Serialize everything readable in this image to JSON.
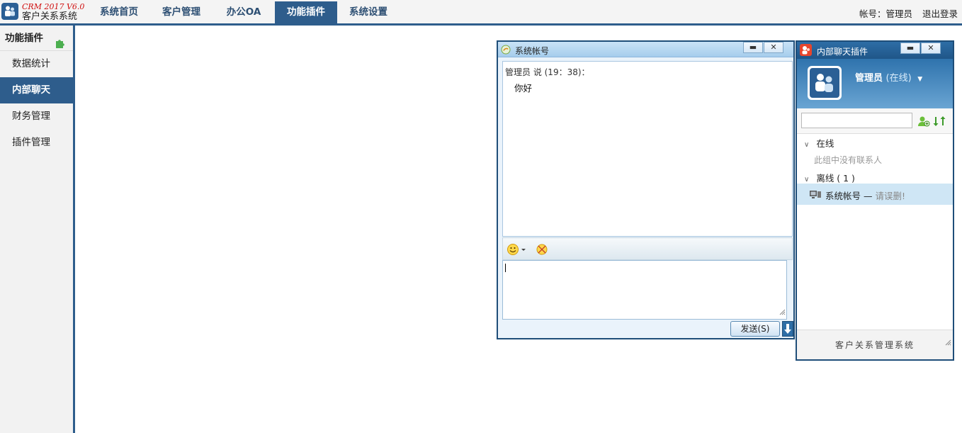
{
  "logo": {
    "line1": "CRM 2017 V6.0",
    "line2": "客户关系系统"
  },
  "nav": [
    {
      "label": "系统首页",
      "active": false
    },
    {
      "label": "客户管理",
      "active": false
    },
    {
      "label": "办公OA",
      "active": false
    },
    {
      "label": "功能插件",
      "active": true
    },
    {
      "label": "系统设置",
      "active": false
    }
  ],
  "user": {
    "account": "帐号：管理员",
    "logout": "退出登录"
  },
  "sidebar": {
    "title": "功能插件",
    "items": [
      {
        "label": "数据统计",
        "active": false
      },
      {
        "label": "内部聊天",
        "active": true
      },
      {
        "label": "财务管理",
        "active": false
      },
      {
        "label": "插件管理",
        "active": false
      }
    ]
  },
  "chat_window": {
    "title": "系统帐号",
    "message": {
      "head": "管理员 说 (19：38)：",
      "body": "你好"
    },
    "send_label": "发送(S)",
    "input_value": ""
  },
  "chat_panel": {
    "title": "内部聊天插件",
    "user_name": "管理员",
    "user_status": "(在线)",
    "search_value": "",
    "groups": [
      {
        "label": "在线",
        "empty_note": "此组中没有联系人"
      },
      {
        "label": "离线 ( 1 )"
      }
    ],
    "contact": {
      "name": "系统帐号",
      "dash": "—",
      "note": "请误删!"
    },
    "footer": "客户关系管理系统"
  },
  "colors": {
    "brand": "#2e5d8c",
    "active_row": "#cfe6f5",
    "logo_red": "#d01010"
  }
}
